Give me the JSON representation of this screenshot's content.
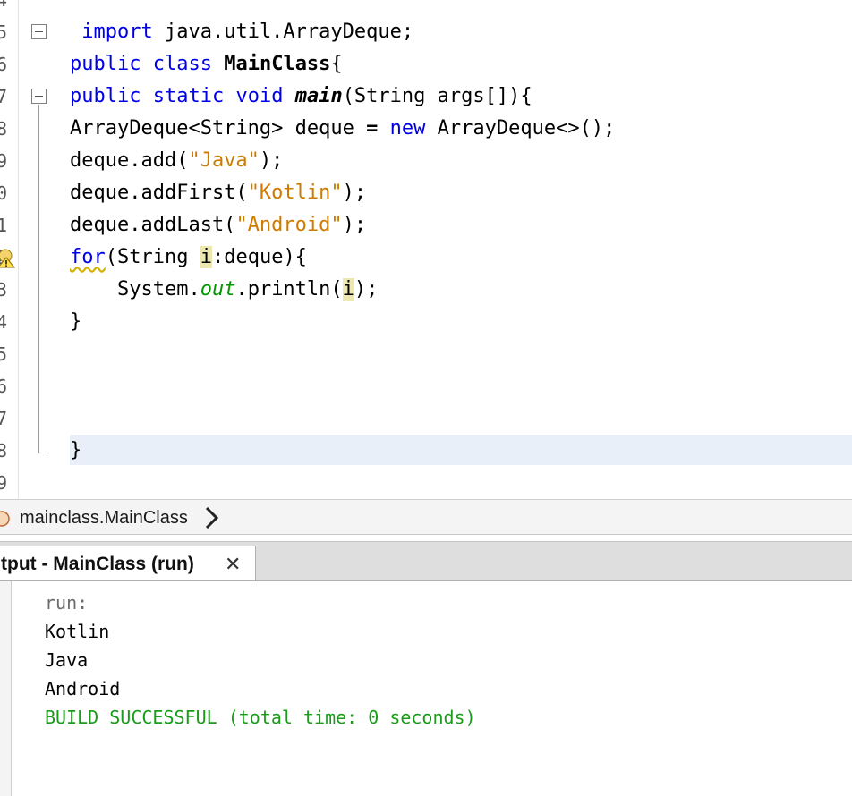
{
  "editor": {
    "line_numbers": [
      "4",
      "5",
      "6",
      "7",
      "8",
      "9",
      "0",
      "1",
      "2",
      "3",
      "4",
      "5",
      "6",
      "7",
      "8",
      "9"
    ],
    "lines": [
      {
        "segments": [
          {
            "t": " "
          },
          {
            "t": "import",
            "c": "kw"
          },
          {
            "t": " java.util.ArrayDeque;"
          }
        ]
      },
      {
        "segments": [
          {
            "t": "public",
            "c": "kw"
          },
          {
            "t": " "
          },
          {
            "t": "class",
            "c": "kw"
          },
          {
            "t": " "
          },
          {
            "t": "MainClass",
            "c": "bold"
          },
          {
            "t": "{"
          }
        ]
      },
      {
        "segments": [
          {
            "t": "public",
            "c": "kw"
          },
          {
            "t": " "
          },
          {
            "t": "static",
            "c": "kw"
          },
          {
            "t": " "
          },
          {
            "t": "void",
            "c": "kw"
          },
          {
            "t": " "
          },
          {
            "t": "main",
            "c": "bold it"
          },
          {
            "t": "(String args[]){"
          }
        ]
      },
      {
        "segments": [
          {
            "t": "ArrayDeque<String> deque "
          },
          {
            "t": "=",
            "c": "bold"
          },
          {
            "t": " "
          },
          {
            "t": "new",
            "c": "kw"
          },
          {
            "t": " ArrayDeque<>();"
          }
        ]
      },
      {
        "segments": [
          {
            "t": "deque.add("
          },
          {
            "t": "\"Java\"",
            "c": "str"
          },
          {
            "t": ");"
          }
        ]
      },
      {
        "segments": [
          {
            "t": "deque.addFirst("
          },
          {
            "t": "\"Kotlin\"",
            "c": "str"
          },
          {
            "t": ");"
          }
        ]
      },
      {
        "segments": [
          {
            "t": "deque.addLast("
          },
          {
            "t": "\"Android\"",
            "c": "str"
          },
          {
            "t": ");"
          }
        ]
      },
      {
        "segments": [
          {
            "t": "for",
            "c": "kw uline"
          },
          {
            "t": "(String "
          },
          {
            "t": "i",
            "c": "hl"
          },
          {
            "t": ":deque){"
          }
        ]
      },
      {
        "segments": [
          {
            "t": "    System."
          },
          {
            "t": "out",
            "c": "out-field"
          },
          {
            "t": ".println("
          },
          {
            "t": "i",
            "c": "hl"
          },
          {
            "t": ");"
          }
        ]
      },
      {
        "segments": [
          {
            "t": "}"
          }
        ]
      },
      {
        "segments": [
          {
            "t": ""
          }
        ]
      },
      {
        "segments": [
          {
            "t": ""
          }
        ]
      },
      {
        "segments": [
          {
            "t": ""
          }
        ]
      },
      {
        "segments": [
          {
            "t": "}"
          }
        ]
      }
    ]
  },
  "breadcrumb": {
    "path": "mainclass.MainClass"
  },
  "output": {
    "tab_label": "tput - MainClass (run)",
    "close_glyph": "✕",
    "lines": [
      {
        "text": "run:",
        "c": "out-gray"
      },
      {
        "text": "Kotlin",
        "c": ""
      },
      {
        "text": "Java",
        "c": ""
      },
      {
        "text": "Android",
        "c": ""
      },
      {
        "text": "BUILD SUCCESSFUL (total time: 0 seconds)",
        "c": "out-green"
      }
    ]
  },
  "icons": {
    "fold": "collapse-icon",
    "warning": "warning-bulb-icon",
    "class": "class-node-icon",
    "chevron": "chevron-right-icon",
    "close": "close-icon"
  },
  "colors": {
    "keyword": "#0000e6",
    "string": "#ce7b00",
    "field": "#009900",
    "build_success": "#1a9c1a",
    "current_line": "#e9eff8"
  }
}
